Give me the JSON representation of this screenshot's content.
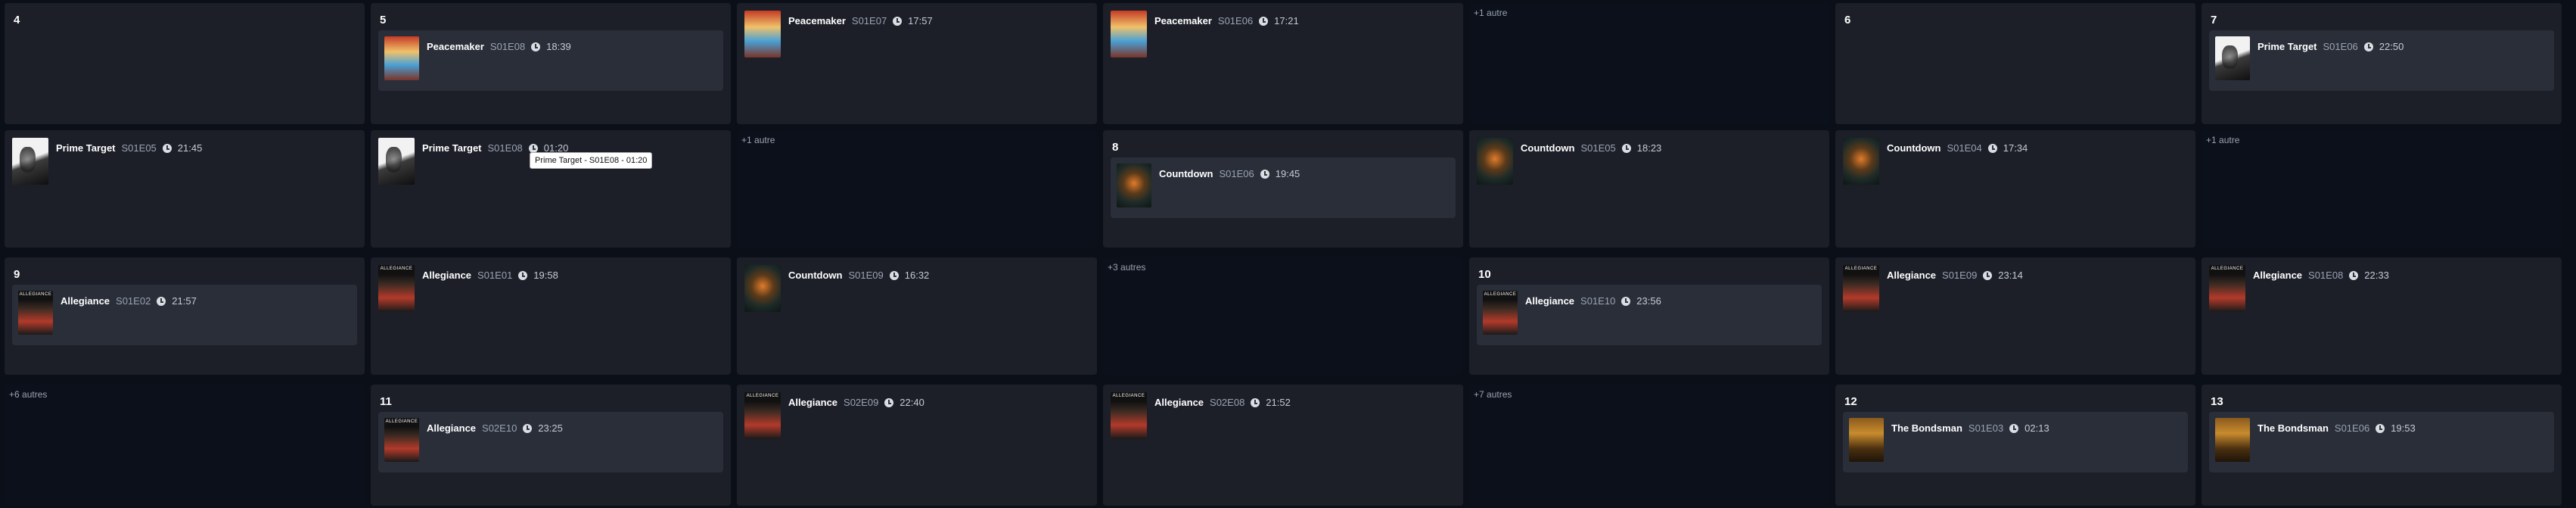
{
  "calendar": {
    "cells": [
      {
        "day": "4",
        "more": "",
        "events": []
      },
      {
        "day": "5",
        "more": "",
        "events": [
          {
            "title": "Peacemaker",
            "code": "S01E08",
            "time": "18:39",
            "poster": "peacemaker",
            "boxed": true
          }
        ]
      },
      {
        "day": "",
        "more": "",
        "events": [
          {
            "title": "Peacemaker",
            "code": "S01E07",
            "time": "17:57",
            "poster": "peacemaker",
            "boxed": false
          }
        ]
      },
      {
        "day": "",
        "more": "",
        "events": [
          {
            "title": "Peacemaker",
            "code": "S01E06",
            "time": "17:21",
            "poster": "peacemaker",
            "boxed": false
          }
        ]
      },
      {
        "day": "",
        "more": "+1 autre",
        "events": []
      },
      {
        "day": "6",
        "more": "",
        "events": []
      },
      {
        "day": "7",
        "more": "",
        "events": [
          {
            "title": "Prime Target",
            "code": "S01E06",
            "time": "22:50",
            "poster": "prime",
            "boxed": true
          }
        ]
      },
      {
        "day": "",
        "more": "",
        "events": [
          {
            "title": "Prime Target",
            "code": "S01E05",
            "time": "21:45",
            "poster": "prime",
            "boxed": false
          }
        ]
      },
      {
        "day": "",
        "more": "",
        "events": [
          {
            "title": "Prime Target",
            "code": "S01E08",
            "time": "01:20",
            "poster": "prime",
            "boxed": false
          }
        ]
      },
      {
        "day": "",
        "more": "+1 autre",
        "events": []
      },
      {
        "day": "8",
        "more": "",
        "events": [
          {
            "title": "Countdown",
            "code": "S01E06",
            "time": "19:45",
            "poster": "countdown",
            "boxed": true
          }
        ]
      },
      {
        "day": "",
        "more": "",
        "events": [
          {
            "title": "Countdown",
            "code": "S01E05",
            "time": "18:23",
            "poster": "countdown",
            "boxed": false
          }
        ]
      },
      {
        "day": "",
        "more": "",
        "events": [
          {
            "title": "Countdown",
            "code": "S01E04",
            "time": "17:34",
            "poster": "countdown",
            "boxed": false
          }
        ]
      },
      {
        "day": "",
        "more": "+1 autre",
        "events": []
      },
      {
        "day": "9",
        "more": "",
        "events": [
          {
            "title": "Allegiance",
            "code": "S01E02",
            "time": "21:57",
            "poster": "allegiance",
            "boxed": true
          }
        ]
      },
      {
        "day": "",
        "more": "",
        "events": [
          {
            "title": "Allegiance",
            "code": "S01E01",
            "time": "19:58",
            "poster": "allegiance",
            "boxed": false
          }
        ]
      },
      {
        "day": "",
        "more": "",
        "events": [
          {
            "title": "Countdown",
            "code": "S01E09",
            "time": "16:32",
            "poster": "countdown",
            "boxed": false
          }
        ]
      },
      {
        "day": "",
        "more": "+3 autres",
        "events": []
      },
      {
        "day": "10",
        "more": "",
        "events": [
          {
            "title": "Allegiance",
            "code": "S01E10",
            "time": "23:56",
            "poster": "allegiance",
            "boxed": true
          }
        ]
      },
      {
        "day": "",
        "more": "",
        "events": [
          {
            "title": "Allegiance",
            "code": "S01E09",
            "time": "23:14",
            "poster": "allegiance",
            "boxed": false
          }
        ]
      },
      {
        "day": "",
        "more": "",
        "events": [
          {
            "title": "Allegiance",
            "code": "S01E08",
            "time": "22:33",
            "poster": "allegiance",
            "boxed": false
          }
        ]
      },
      {
        "day": "",
        "more": "+6 autres",
        "events": []
      },
      {
        "day": "11",
        "more": "",
        "events": [
          {
            "title": "Allegiance",
            "code": "S02E10",
            "time": "23:25",
            "poster": "allegiance",
            "boxed": true
          }
        ]
      },
      {
        "day": "",
        "more": "",
        "events": [
          {
            "title": "Allegiance",
            "code": "S02E09",
            "time": "22:40",
            "poster": "allegiance",
            "boxed": false
          }
        ]
      },
      {
        "day": "",
        "more": "",
        "events": [
          {
            "title": "Allegiance",
            "code": "S02E08",
            "time": "21:52",
            "poster": "allegiance",
            "boxed": false
          }
        ]
      },
      {
        "day": "",
        "more": "+7 autres",
        "events": []
      },
      {
        "day": "12",
        "more": "",
        "events": [
          {
            "title": "The Bondsman",
            "code": "S01E03",
            "time": "02:13",
            "poster": "bondsman",
            "boxed": true
          }
        ]
      },
      {
        "day": "13",
        "more": "",
        "events": [
          {
            "title": "The Bondsman",
            "code": "S01E06",
            "time": "19:53",
            "poster": "bondsman",
            "boxed": true
          }
        ]
      }
    ]
  },
  "tooltip": {
    "text": "Prime Target - S01E08 - 01:20"
  },
  "colors": {
    "background": "#0b0f18",
    "cell": "#1c1f28",
    "event_box": "#2a2e39",
    "muted_text": "#9aa3b2"
  }
}
